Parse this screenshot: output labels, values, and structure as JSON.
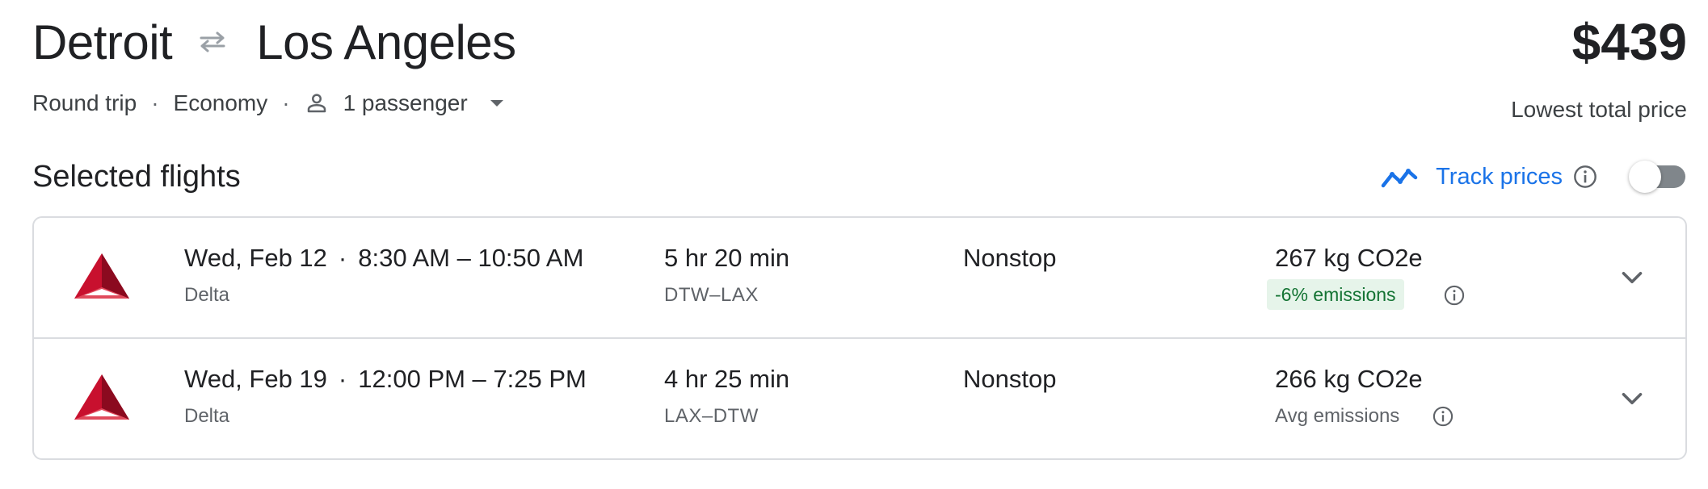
{
  "header": {
    "origin": "Detroit",
    "destination": "Los Angeles",
    "price": "$439",
    "price_caption": "Lowest total price"
  },
  "trip": {
    "type": "Round trip",
    "separator": "·",
    "cabin": "Economy",
    "passengers": "1 passenger"
  },
  "selected": {
    "title": "Selected flights",
    "track_label": "Track prices",
    "track_enabled": false
  },
  "flights": [
    {
      "date": "Wed, Feb 12",
      "time_range": "8:30 AM – 10:50 AM",
      "airline": "Delta",
      "duration": "5 hr 20 min",
      "airports": "DTW–LAX",
      "stops": "Nonstop",
      "co2": "267 kg CO2e",
      "emissions": "-6% emissions"
    },
    {
      "date": "Wed, Feb 19",
      "time_range": "12:00 PM – 7:25 PM",
      "airline": "Delta",
      "duration": "4 hr 25 min",
      "airports": "LAX–DTW",
      "stops": "Nonstop",
      "co2": "266 kg CO2e",
      "emissions": "Avg emissions"
    }
  ],
  "colors": {
    "accent": "#1a73e8",
    "delta_red": "#c8102e",
    "emissions_green_bg": "#e6f4ea",
    "emissions_green_text": "#137333"
  },
  "icons": {
    "swap": "swap-arrows-icon",
    "person": "person-icon",
    "dropdown": "dropdown-arrow-icon",
    "trend": "trend-line-icon",
    "info": "info-icon",
    "airline_logo": "delta-logo-icon",
    "expand": "chevron-down-icon"
  }
}
